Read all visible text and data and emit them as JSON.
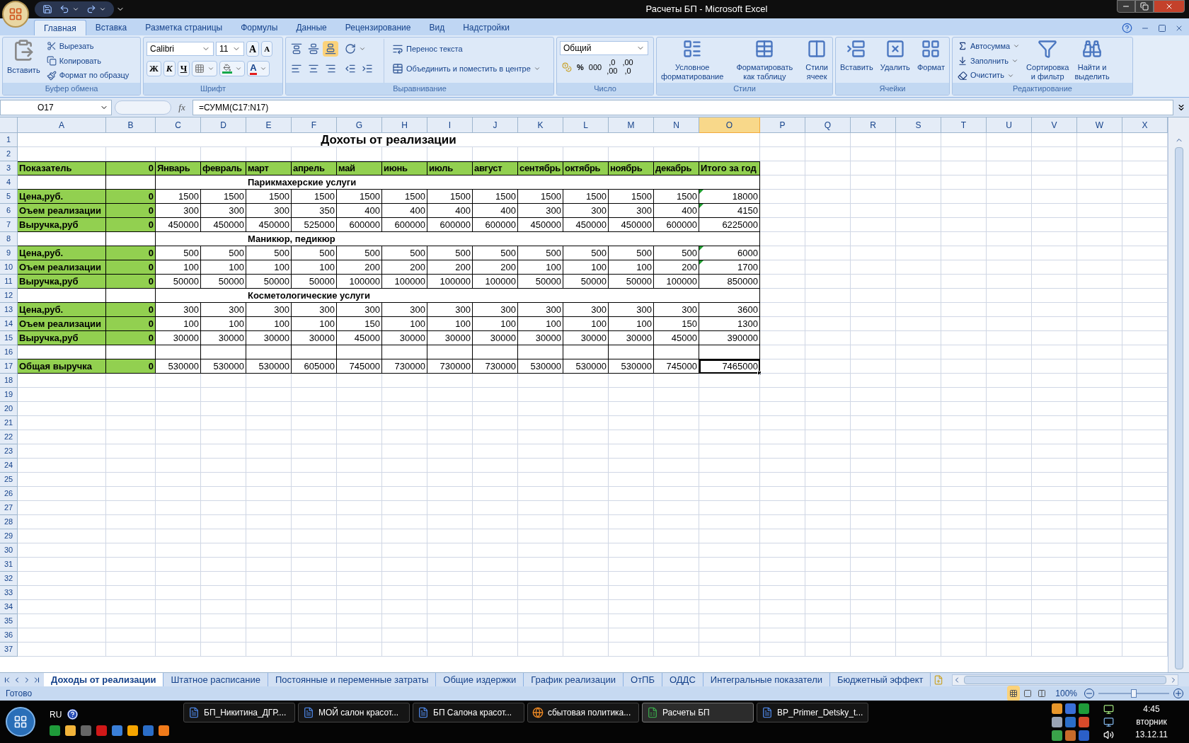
{
  "window": {
    "title": "Расчеты БП - Microsoft Excel"
  },
  "ribbon_tabs": [
    {
      "label": "Главная",
      "selected": true
    },
    {
      "label": "Вставка",
      "selected": false
    },
    {
      "label": "Разметка страницы",
      "selected": false
    },
    {
      "label": "Формулы",
      "selected": false
    },
    {
      "label": "Данные",
      "selected": false
    },
    {
      "label": "Рецензирование",
      "selected": false
    },
    {
      "label": "Вид",
      "selected": false
    },
    {
      "label": "Надстройки",
      "selected": false
    }
  ],
  "clipboard": {
    "title": "Буфер обмена",
    "paste": "Вставить",
    "items": [
      "Вырезать",
      "Копировать",
      "Формат по образцу"
    ]
  },
  "font": {
    "title": "Шрифт",
    "name": "Calibri",
    "size": "11",
    "grow": "A",
    "shrink": "A",
    "bold": "Ж",
    "italic": "К",
    "underline": "Ч",
    "font_color": "A"
  },
  "alignment": {
    "title": "Выравнивание",
    "wrap": "Перенос текста",
    "merge": "Объединить и поместить в центре"
  },
  "number": {
    "title": "Число",
    "format": "Общий",
    "percent": "%",
    "thousands": "000",
    "increase_decimal": [
      ",0",
      ",00"
    ],
    "decrease_decimal": [
      ",00",
      ",0"
    ]
  },
  "styles": {
    "title": "Стили",
    "buttons": [
      [
        "Условное",
        "форматирование"
      ],
      [
        "Форматировать",
        "как таблицу"
      ],
      [
        "Стили",
        "ячеек"
      ]
    ]
  },
  "cells": {
    "title": "Ячейки",
    "buttons": [
      "Вставить",
      "Удалить",
      "Формат"
    ]
  },
  "editing": {
    "title": "Редактирование",
    "items": [
      "Автосумма",
      "Заполнить",
      "Очистить"
    ],
    "buttons": [
      [
        "Сортировка",
        "и фильтр"
      ],
      [
        "Найти и",
        "выделить"
      ]
    ]
  },
  "formula_bar": {
    "name_box": "O17",
    "fx": "fx",
    "formula": "=СУММ(C17:N17)"
  },
  "columns": [
    {
      "label": "A",
      "selected": false
    },
    {
      "label": "B",
      "selected": false
    },
    {
      "label": "C",
      "selected": false
    },
    {
      "label": "D",
      "selected": false
    },
    {
      "label": "E",
      "selected": false
    },
    {
      "label": "F",
      "selected": false
    },
    {
      "label": "G",
      "selected": false
    },
    {
      "label": "H",
      "selected": false
    },
    {
      "label": "I",
      "selected": false
    },
    {
      "label": "J",
      "selected": false
    },
    {
      "label": "K",
      "selected": false
    },
    {
      "label": "L",
      "selected": false
    },
    {
      "label": "M",
      "selected": false
    },
    {
      "label": "N",
      "selected": false
    },
    {
      "label": "O",
      "selected": true
    },
    {
      "label": "P",
      "selected": false
    },
    {
      "label": "Q",
      "selected": false
    },
    {
      "label": "R",
      "selected": false
    },
    {
      "label": "S",
      "selected": false
    },
    {
      "label": "T",
      "selected": false
    },
    {
      "label": "U",
      "selected": false
    },
    {
      "label": "V",
      "selected": false
    },
    {
      "label": "W",
      "selected": false
    },
    {
      "label": "X",
      "selected": false
    }
  ],
  "row_numbers": [
    "1",
    "2",
    "3",
    "4",
    "5",
    "6",
    "7",
    "8",
    "9",
    "10",
    "11",
    "12",
    "13",
    "14",
    "15",
    "16",
    "17",
    "18",
    "19",
    "20",
    "21",
    "22",
    "23",
    "24",
    "25",
    "26",
    "27",
    "28",
    "29",
    "30",
    "31",
    "32",
    "33",
    "34",
    "35",
    "36",
    "37"
  ],
  "sheet": {
    "title": "Дохоты от реализации",
    "header": {
      "label": "Показатель",
      "b": "0",
      "months": [
        "Январь",
        "февраль",
        "март",
        "апрель",
        "май",
        "июнь",
        "июль",
        "август",
        "сентябрь",
        "октябрь",
        "ноябрь",
        "декабрь"
      ],
      "total": "Итого за год"
    },
    "sections": [
      {
        "title": "Парикмахерские услуги",
        "rows": [
          {
            "label": "Цена,руб.",
            "b": "0",
            "values": [
              "1500",
              "1500",
              "1500",
              "1500",
              "1500",
              "1500",
              "1500",
              "1500",
              "1500",
              "1500",
              "1500",
              "1500"
            ],
            "total": "18000",
            "flagged": true
          },
          {
            "label": "Оъем реализации",
            "b": "0",
            "values": [
              "300",
              "300",
              "300",
              "350",
              "400",
              "400",
              "400",
              "400",
              "300",
              "300",
              "300",
              "400"
            ],
            "total": "4150",
            "flagged": true
          },
          {
            "label": "Выручка,руб",
            "b": "0",
            "values": [
              "450000",
              "450000",
              "450000",
              "525000",
              "600000",
              "600000",
              "600000",
              "600000",
              "450000",
              "450000",
              "450000",
              "600000"
            ],
            "total": "6225000",
            "flagged": false
          }
        ]
      },
      {
        "title": "Маникюр, педикюр",
        "rows": [
          {
            "label": "Цена,руб.",
            "b": "0",
            "values": [
              "500",
              "500",
              "500",
              "500",
              "500",
              "500",
              "500",
              "500",
              "500",
              "500",
              "500",
              "500"
            ],
            "total": "6000",
            "flagged": true
          },
          {
            "label": "Оъем реализации",
            "b": "0",
            "values": [
              "100",
              "100",
              "100",
              "100",
              "200",
              "200",
              "200",
              "200",
              "100",
              "100",
              "100",
              "200"
            ],
            "total": "1700",
            "flagged": true
          },
          {
            "label": "Выручка,руб",
            "b": "0",
            "values": [
              "50000",
              "50000",
              "50000",
              "50000",
              "100000",
              "100000",
              "100000",
              "100000",
              "50000",
              "50000",
              "50000",
              "100000"
            ],
            "total": "850000",
            "flagged": false
          }
        ]
      },
      {
        "title": "Косметологические услуги",
        "rows": [
          {
            "label": "Цена,руб.",
            "b": "0",
            "values": [
              "300",
              "300",
              "300",
              "300",
              "300",
              "300",
              "300",
              "300",
              "300",
              "300",
              "300",
              "300"
            ],
            "total": "3600",
            "flagged": false
          },
          {
            "label": "Оъем реализации",
            "b": "0",
            "values": [
              "100",
              "100",
              "100",
              "100",
              "150",
              "100",
              "100",
              "100",
              "100",
              "100",
              "100",
              "150"
            ],
            "total": "1300",
            "flagged": false
          },
          {
            "label": "Выручка,руб",
            "b": "0",
            "values": [
              "30000",
              "30000",
              "30000",
              "30000",
              "45000",
              "30000",
              "30000",
              "30000",
              "30000",
              "30000",
              "30000",
              "45000"
            ],
            "total": "390000",
            "flagged": false
          }
        ]
      }
    ],
    "grand_total": {
      "label": "Общая выручка",
      "b": "0",
      "values": [
        "530000",
        "530000",
        "530000",
        "605000",
        "745000",
        "730000",
        "730000",
        "730000",
        "530000",
        "530000",
        "530000",
        "745000"
      ],
      "total": "7465000",
      "selected": true
    }
  },
  "sheet_tabs": [
    {
      "label": "Доходы от реализации",
      "selected": true
    },
    {
      "label": "Штатное расписание",
      "selected": false
    },
    {
      "label": "Постоянные и переменные затраты",
      "selected": false
    },
    {
      "label": "Общие издержки",
      "selected": false
    },
    {
      "label": "График реализации",
      "selected": false
    },
    {
      "label": "ОтПБ",
      "selected": false
    },
    {
      "label": "ОДДС",
      "selected": false
    },
    {
      "label": "Интегральные показатели",
      "selected": false
    },
    {
      "label": "Бюджетный эффект",
      "selected": false
    }
  ],
  "status_bar": {
    "text": "Готово",
    "zoom": "100%",
    "level": 0.5
  },
  "taskbar": {
    "language": "RU",
    "tasks": [
      {
        "label": "БП_Никитина_ДГР....",
        "kind": "word",
        "selected": false
      },
      {
        "label": "МОЙ салон красот...",
        "kind": "word",
        "selected": false
      },
      {
        "label": "БП Салона красот...",
        "kind": "word",
        "selected": false
      },
      {
        "label": "сбытовая политика...",
        "kind": "browser",
        "selected": false
      },
      {
        "label": "Расчеты БП",
        "kind": "excel",
        "selected": true
      },
      {
        "label": "BP_Primer_Detsky_t...",
        "kind": "word",
        "selected": false
      }
    ],
    "time": "4:45",
    "day": "вторник",
    "date": "13.12.11"
  }
}
